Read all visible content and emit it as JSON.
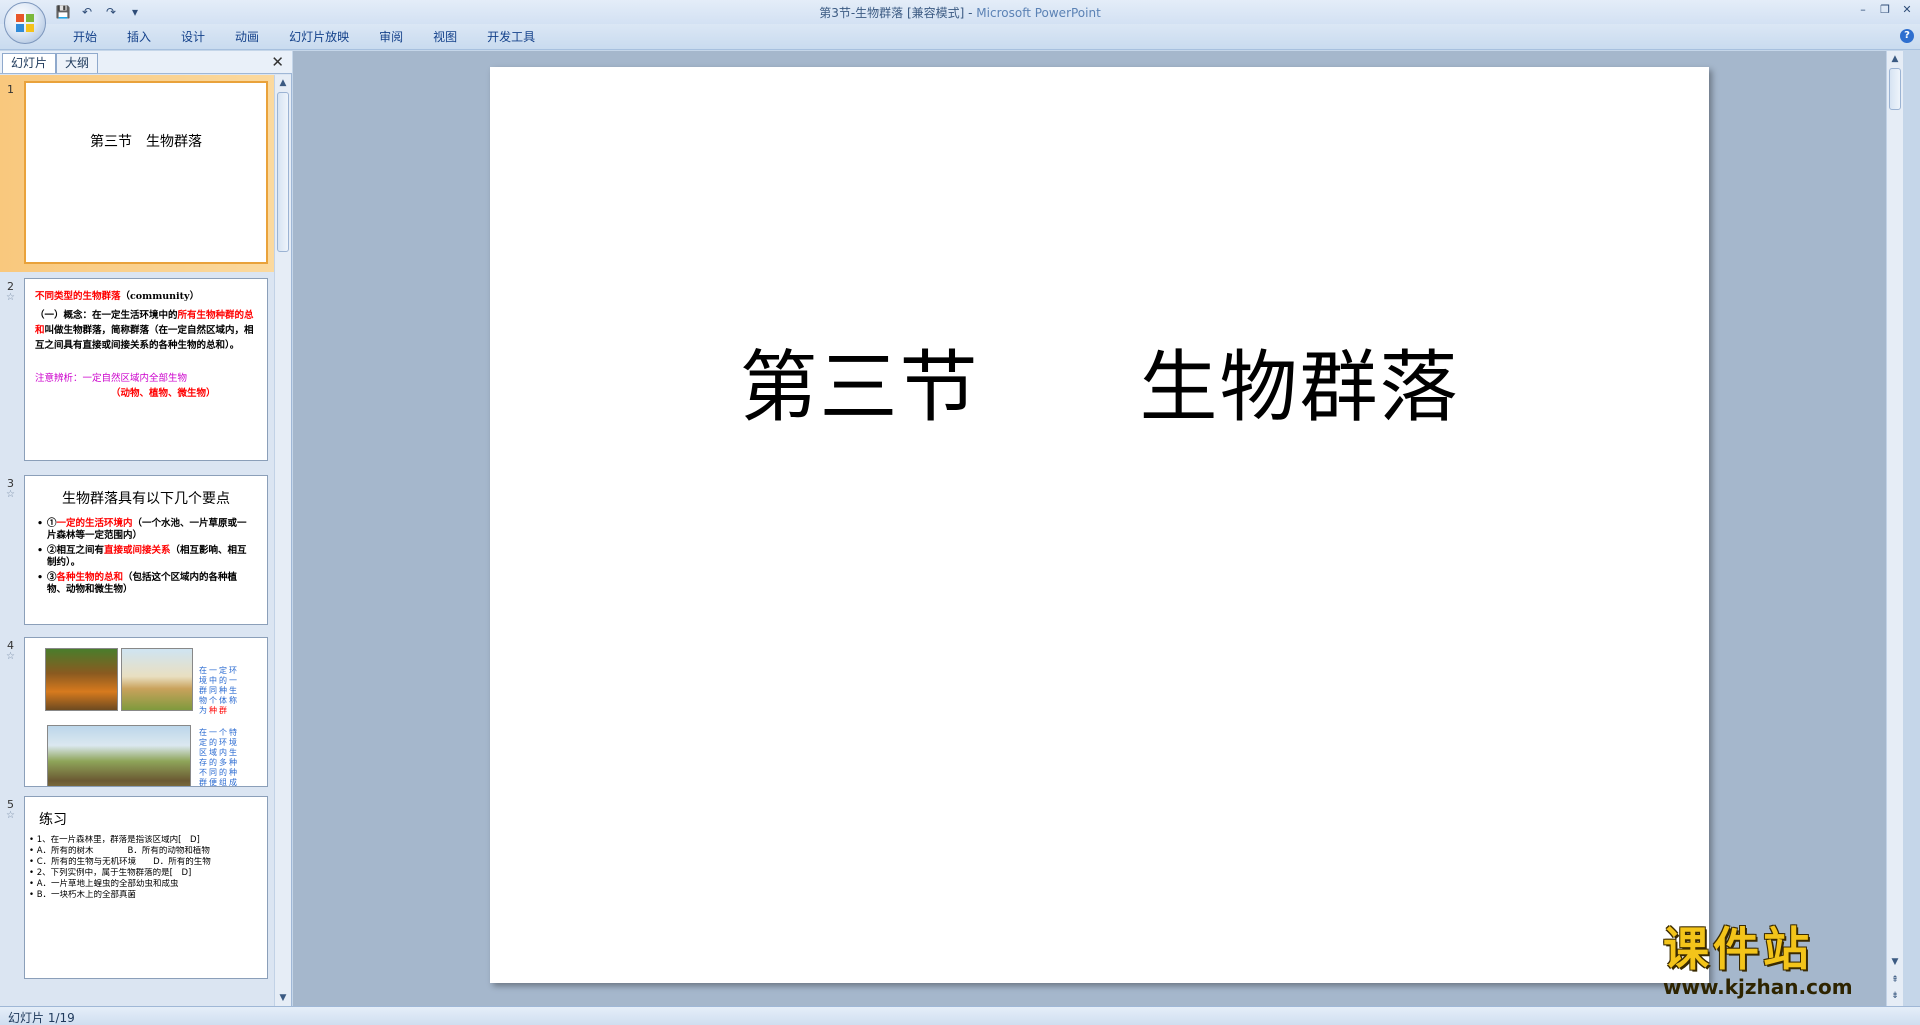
{
  "window": {
    "title": "第3节-生物群落 [兼容模式] - ",
    "app_name": "Microsoft PowerPoint",
    "controls": [
      "–",
      "❐",
      "✕"
    ]
  },
  "quick_access": {
    "save_icon": "💾",
    "undo_icon": "↶",
    "redo_icon": "↷",
    "customize_icon": "▾"
  },
  "ribbon": {
    "tabs": [
      "开始",
      "插入",
      "设计",
      "动画",
      "幻灯片放映",
      "审阅",
      "视图",
      "开发工具"
    ],
    "help_label": "?"
  },
  "left_pane": {
    "tab_slides": "幻灯片",
    "tab_outline": "大纲",
    "close_label": "✕"
  },
  "slides": [
    {
      "number": "1",
      "title": "第三节　生物群落"
    },
    {
      "number": "2",
      "star": "☆",
      "heading_red": "不同类型的生物群落",
      "heading_black": "（community）",
      "p1_a": "（一）概念：在一定生活环境中的",
      "p1_red": "所有生物种群的总和",
      "p1_b": "叫做生物群落，简称群落（在一定自然区域内，相互之间具有直接或间接关系的各种生物的总和）。",
      "note": "注意辨析：一定自然区域内全部生物",
      "note2": "（动物、植物、微生物）"
    },
    {
      "number": "3",
      "star": "☆",
      "title": "生物群落具有以下几个要点",
      "b1_num": "①",
      "b1_red": "一定的生活环境内",
      "b1_rest": "（一个水池、一片草原或一片森林等一定范围内）",
      "b2_a": "②相互之间有",
      "b2_red": "直接或间接关系",
      "b2_rest": "（相互影响、相互制约）。",
      "b3_num": "③",
      "b3_red": "各种生物的总和",
      "b3_rest": "（包括这个区域内的各种植物、动物和微生物）"
    },
    {
      "number": "4",
      "star": "☆",
      "text1_a": "在一定环境中的一群同种生物个体称为",
      "text1_red": "种群",
      "text2": "在一个特定的环境区域内生存的多种不同的种群便组成为群落。"
    },
    {
      "number": "5",
      "star": "☆",
      "title": "练习",
      "lines": [
        "• 1、在一片森林里，群落是指该区域内[　D]",
        "• A．所有的树木　　　　B．所有的动物和植物",
        "• C．所有的生物与无机环境　　D．所有的生物",
        "• 2、下列实例中，属于生物群落的是[　D]",
        "• A．一片草地上蝗虫的全部幼虫和成虫",
        "• B．一块朽木上的全部真菌"
      ]
    }
  ],
  "main_slide": {
    "title": "第三节　　生物群落"
  },
  "watermark": {
    "text": "课件站",
    "url": "www.kjzhan.com"
  },
  "status": {
    "slide_position": "幻灯片 1/19"
  },
  "colors": {
    "ribbon_bg": "#d3e1f3",
    "workspace_bg": "#a5b7cc",
    "selected_thumb": "#f9c87d",
    "accent_red": "#ff0000"
  }
}
